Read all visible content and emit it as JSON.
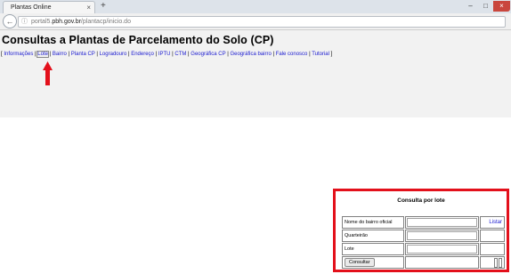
{
  "browser": {
    "tab_title": "Plantas Online",
    "tab_close": "×",
    "new_tab": "+",
    "url_prefix": "portal5.",
    "url_domain": "pbh.gov.br",
    "url_path": "/plantacp/inicio.do",
    "back_glyph": "←",
    "info_glyph": "ⓘ",
    "minimize_glyph": "–",
    "maximize_glyph": "□",
    "close_glyph": "×"
  },
  "page": {
    "title": "Consultas a Plantas de Parcelamento do Solo (CP)",
    "menu": {
      "open_bracket": "[",
      "close_bracket": "]",
      "separator": "|",
      "items": [
        "Informações",
        "Lote",
        "Bairro",
        "Planta CP",
        "Logradouro",
        "Endereço",
        "IPTU",
        "CTM",
        "Geográfica CP",
        "Geográfica bairro",
        "Fale conosco",
        "Tutorial"
      ]
    }
  },
  "form": {
    "title": "Consulta por lote",
    "rows": {
      "bairro_label": "Nome do bairro oficial",
      "bairro_value": "",
      "listar_label": "Listar",
      "quarteirao_label": "Quarteirão",
      "quarteirao_value": "",
      "lote_label": "Lote",
      "lote_value": ""
    },
    "submit_label": "Consultar"
  },
  "colors": {
    "highlight_red": "#e3101b",
    "link_blue": "#1a1ad0"
  }
}
